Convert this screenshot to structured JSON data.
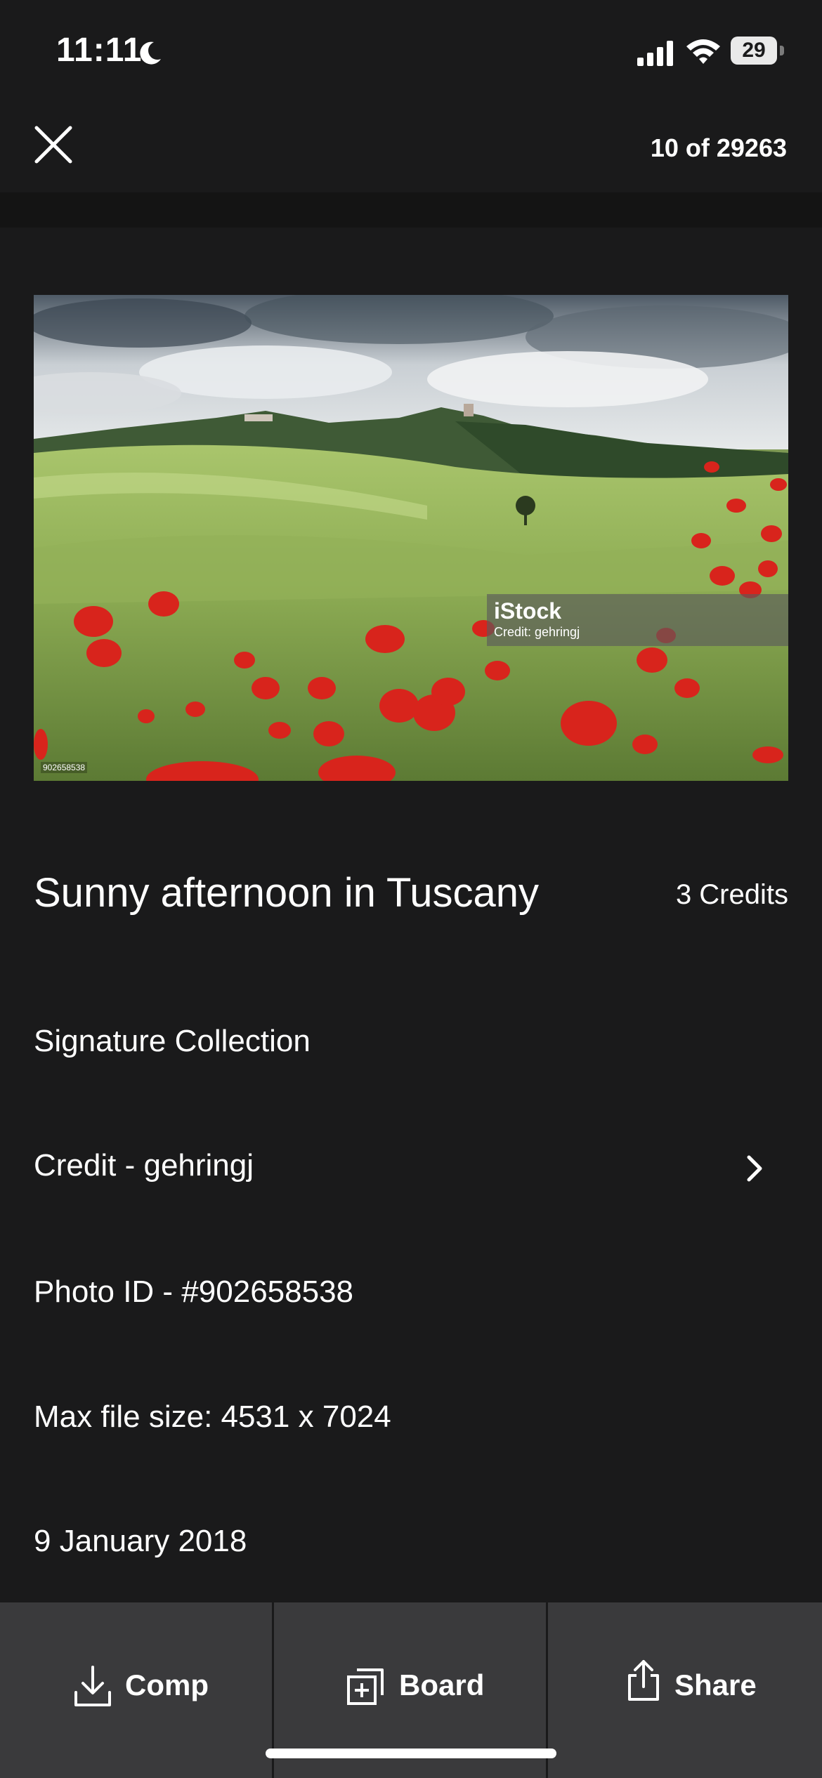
{
  "status_bar": {
    "time": "11:11",
    "battery": "29"
  },
  "header": {
    "counter": "10 of 29263"
  },
  "photo": {
    "watermark_brand": "iStock",
    "watermark_credit": "Credit: gehringj",
    "stamp_id": "902658538"
  },
  "details": {
    "title": "Sunny afternoon in Tuscany",
    "price": "3 Credits",
    "collection": "Signature Collection",
    "credit": "Credit - gehringj",
    "photo_id": "Photo ID - #902658538",
    "max_file_size": "Max file size: 4531 x 7024",
    "date": "9 January 2018"
  },
  "actions": {
    "comp": "Comp",
    "board": "Board",
    "share": "Share"
  },
  "icons": {
    "close": "close-icon",
    "moon": "moon-icon",
    "signal": "signal-icon",
    "wifi": "wifi-icon",
    "battery": "battery-icon",
    "chevron": "chevron-right-icon",
    "download": "download-icon",
    "board_add": "board-add-icon",
    "share": "share-icon"
  },
  "colors": {
    "background": "#1a1a1b",
    "bottom_bar": "#3a3a3c",
    "text": "#ffffff",
    "poppy_red": "#d8241c"
  }
}
